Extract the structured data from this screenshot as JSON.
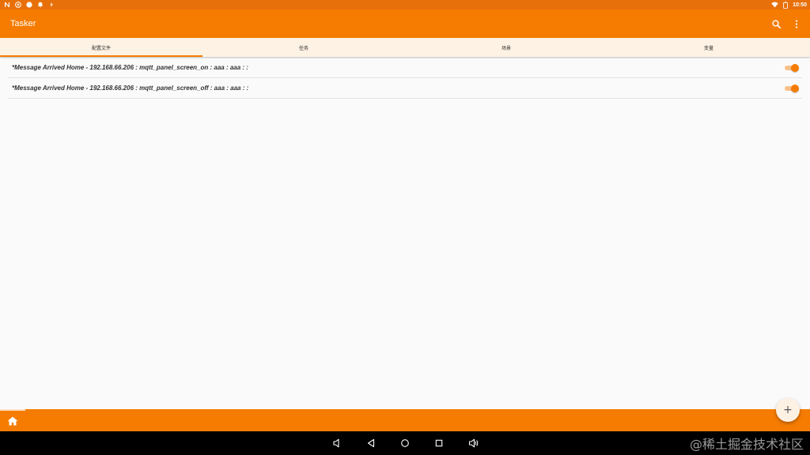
{
  "status_bar": {
    "time": "10:50",
    "left_icons": [
      "n-icon",
      "vpn-icon",
      "circle-icon",
      "notification-bell-icon",
      "flash-icon"
    ],
    "right_icons": [
      "wifi-icon",
      "battery-icon"
    ]
  },
  "app_bar": {
    "title": "Tasker",
    "actions": [
      "search-icon",
      "more-vert-icon"
    ]
  },
  "tabs": [
    {
      "label": "配置文件",
      "active": true
    },
    {
      "label": "任务",
      "active": false
    },
    {
      "label": "场景",
      "active": false
    },
    {
      "label": "变量",
      "active": false
    }
  ],
  "profiles": [
    {
      "label": "*Message Arrived Home - 192.168.66.206 : mqtt_panel_screen_on : aaa : aaa : :",
      "enabled": true
    },
    {
      "label": "*Message Arrived Home - 192.168.66.206 : mqtt_panel_screen_off : aaa : aaa : :",
      "enabled": true
    }
  ],
  "fab": {
    "label": "+"
  },
  "bottom_bar": {
    "icon": "home-icon"
  },
  "nav_bar": {
    "buttons": [
      "volume-down-icon",
      "back-icon",
      "home-circle-icon",
      "recents-icon",
      "volume-up-icon"
    ]
  },
  "watermark": "@稀土掘金技术社区",
  "colors": {
    "primary": "#f57c00",
    "status_bar": "#e8700a",
    "tab_bg": "#fdf2e3",
    "toggle_track": "#f8c089",
    "background": "#fafafa"
  }
}
